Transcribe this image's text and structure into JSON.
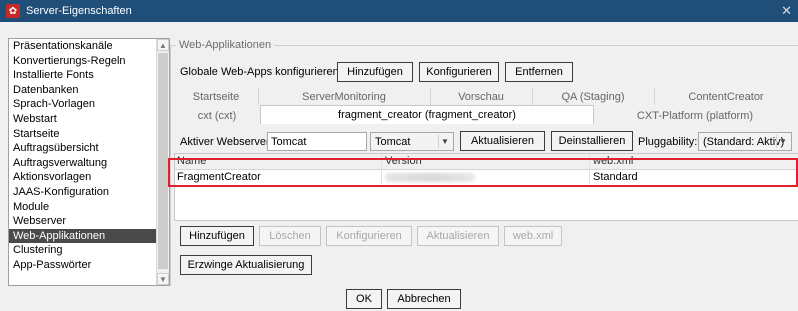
{
  "window": {
    "title": "Server-Eigenschaften",
    "close_glyph": "✕"
  },
  "sidebar": {
    "items": [
      "Präsentationskanäle",
      "Konvertierungs-Regeln",
      "Installierte Fonts",
      "Datenbanken",
      "Sprach-Vorlagen",
      "Webstart",
      "Startseite",
      "Auftragsübersicht",
      "Auftragsverwaltung",
      "Aktionsvorlagen",
      "JAAS-Konfiguration",
      "Module",
      "Webserver",
      "Web-Applikationen",
      "Clustering",
      "App-Passwörter"
    ],
    "selected": "Web-Applikationen"
  },
  "group_title": "Web-Applikationen",
  "global": {
    "label": "Globale Web-Apps konfigurieren:",
    "add": "Hinzufügen",
    "configure": "Konfigurieren",
    "remove": "Entfernen"
  },
  "tabs_row1": [
    "Startseite",
    "ServerMonitoring",
    "Vorschau",
    "QA (Staging)",
    "ContentCreator"
  ],
  "tabs_row2": [
    "cxt (cxt)",
    "fragment_creator (fragment_creator)",
    "CXT-Platform (platform)"
  ],
  "active_tab": "fragment_creator (fragment_creator)",
  "webserver": {
    "label": "Aktiver Webserver:",
    "value": "Tomcat",
    "combo_value": "Tomcat",
    "update": "Aktualisieren",
    "uninstall": "Deinstallieren",
    "pluggability_label": "Pluggability:",
    "pluggability_value": "(Standard: Aktiv)"
  },
  "table": {
    "headers": {
      "name": "Name",
      "version": "Version",
      "webxml": "web.xml"
    },
    "rows": [
      {
        "name": "FragmentCreator",
        "webxml": "Standard"
      }
    ]
  },
  "actions": {
    "add": "Hinzufügen",
    "delete": "Löschen",
    "configure": "Konfigurieren",
    "update": "Aktualisieren",
    "webxml": "web.xml"
  },
  "force_update": "Erzwinge Aktualisierung",
  "footer": {
    "ok": "OK",
    "cancel": "Abbrechen"
  },
  "colors": {
    "titlebar": "#1f4e79",
    "selection": "#4a4a4a",
    "highlight": "#e0202a"
  }
}
